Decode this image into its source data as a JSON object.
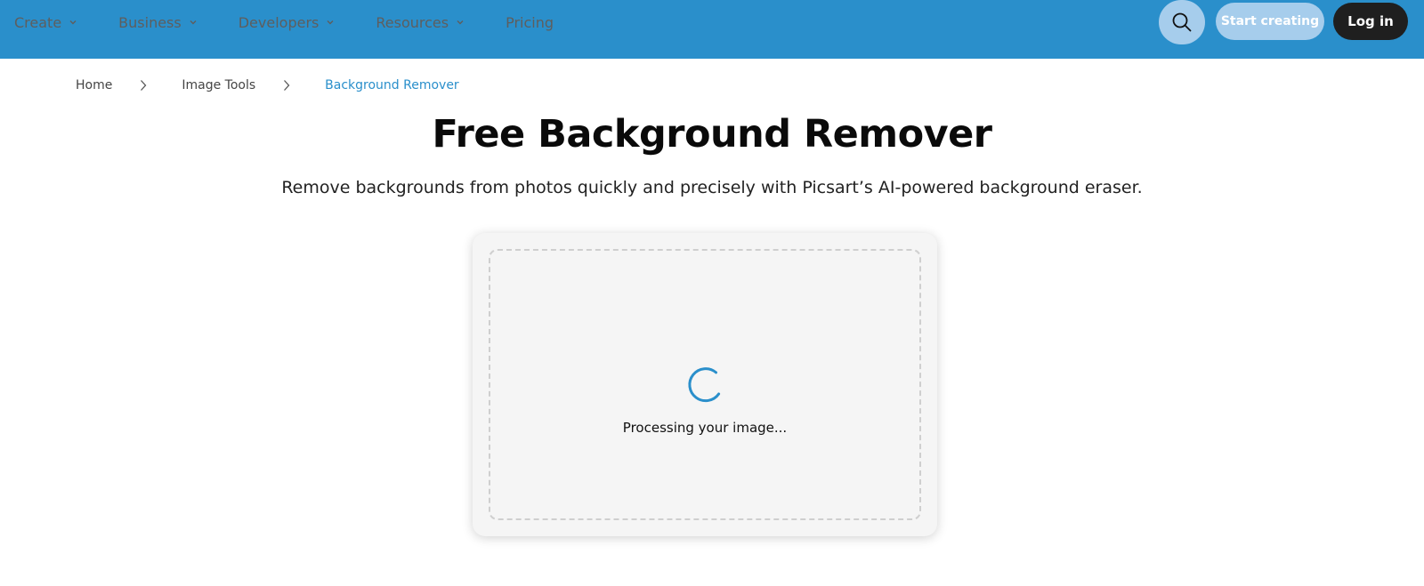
{
  "nav": {
    "items": [
      {
        "label": "Create",
        "has_dropdown": true
      },
      {
        "label": "Business",
        "has_dropdown": true
      },
      {
        "label": "Developers",
        "has_dropdown": true
      },
      {
        "label": "Resources",
        "has_dropdown": true
      },
      {
        "label": "Pricing",
        "has_dropdown": false
      }
    ],
    "search_icon": "search-icon",
    "start_label": "Start creating",
    "login_label": "Log in"
  },
  "breadcrumb": {
    "items": [
      "Home",
      "Image Tools",
      "Background Remover"
    ]
  },
  "hero": {
    "title": "Free Background Remover",
    "subtitle": "Remove backgrounds from photos quickly and precisely with Picsart’s AI-powered background eraser."
  },
  "uploader": {
    "status": "Processing your image...",
    "spinner_icon": "loading-spinner-icon"
  },
  "colors": {
    "header": "#2a8fcb",
    "accent": "#2a8fcb",
    "light_button": "#a6cdec",
    "dark_button": "#1f1f1f"
  }
}
